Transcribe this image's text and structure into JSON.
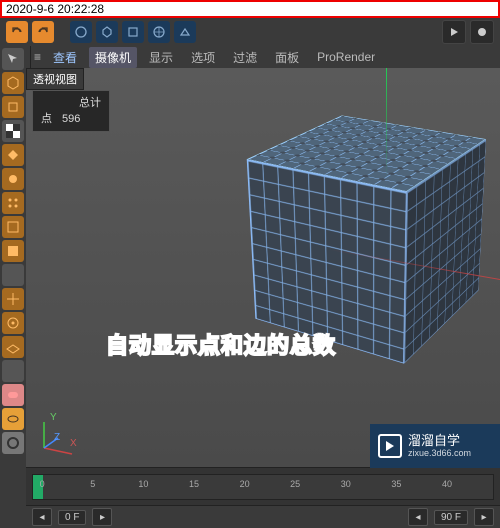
{
  "timestamp": "2020-9-6 20:22:28",
  "menu": {
    "view": "查看",
    "camera": "摄像机",
    "display": "显示",
    "options": "选项",
    "filter": "过滤",
    "panel": "面板",
    "prorender": "ProRender"
  },
  "viewport": {
    "title": "透视视图",
    "hud_total_label": "总计",
    "hud_points_label": "点",
    "hud_points_value": "596"
  },
  "axes": {
    "x": "X",
    "y": "Y",
    "z": "Z"
  },
  "annotation": "自动显示点和边的总数",
  "watermark": {
    "title": "溜溜自学",
    "url": "zixue.3d66.com"
  },
  "timeline": {
    "ticks": [
      "0",
      "5",
      "10",
      "15",
      "20",
      "25",
      "30",
      "35",
      "40"
    ],
    "start_frame": "0 F",
    "end_frame": "90 F",
    "current": "0 F"
  },
  "icons": {
    "undo": "undo-icon",
    "redo": "redo-icon",
    "cursor": "cursor-icon",
    "move": "move-icon",
    "play": "play-icon"
  }
}
